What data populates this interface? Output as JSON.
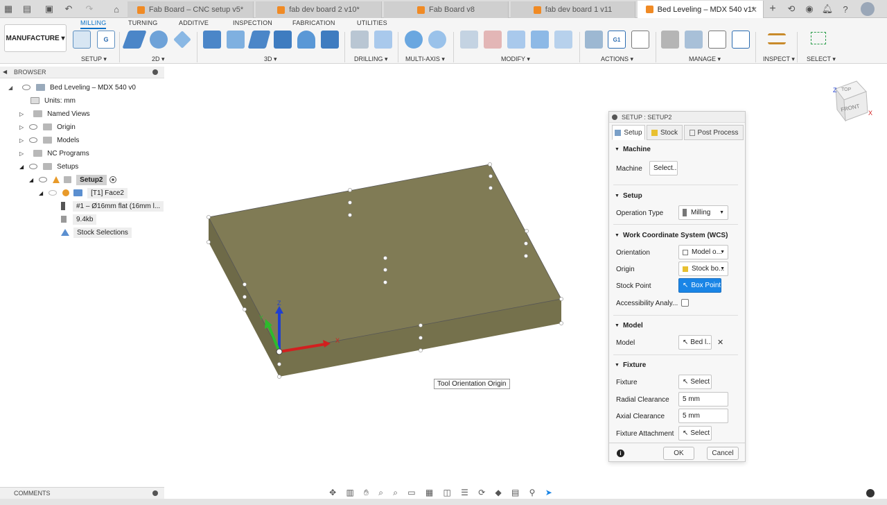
{
  "tabs": [
    {
      "label": "Fab Board – CNC setup v5*"
    },
    {
      "label": "fab dev board 2 v10*"
    },
    {
      "label": "Fab Board v8"
    },
    {
      "label": "fab dev board 1 v11"
    },
    {
      "label": "Bed Leveling – MDX 540 v1*"
    }
  ],
  "ribbon": {
    "workspace": "MANUFACTURE ▾",
    "tabs": [
      "MILLING",
      "TURNING",
      "ADDITIVE",
      "INSPECTION",
      "FABRICATION",
      "UTILITIES"
    ],
    "groups": [
      "SETUP ▾",
      "2D ▾",
      "3D ▾",
      "DRILLING ▾",
      "MULTI-AXIS ▾",
      "MODIFY ▾",
      "ACTIONS ▾",
      "MANAGE ▾",
      "INSPECT ▾",
      "SELECT ▾"
    ]
  },
  "browser": {
    "title": "BROWSER",
    "items": [
      {
        "label": "Bed Leveling – MDX 540 v0"
      },
      {
        "label": "Units: mm"
      },
      {
        "label": "Named Views"
      },
      {
        "label": "Origin"
      },
      {
        "label": "Models"
      },
      {
        "label": "NC Programs"
      },
      {
        "label": "Setups"
      },
      {
        "label": "Setup2"
      },
      {
        "label": "[T1] Face2"
      },
      {
        "label": "#1 – Ø16mm flat (16mm l..."
      },
      {
        "label": "9.4kb"
      },
      {
        "label": "Stock Selections"
      }
    ]
  },
  "viewcube": {
    "top": "TOP",
    "front": "FRONT",
    "x": "X",
    "z": "Z"
  },
  "triad": {
    "x": "X",
    "y": "Y",
    "z": "Z"
  },
  "tooltip": "Tool Orientation Origin",
  "panel": {
    "title": "SETUP : SETUP2",
    "tabs": [
      "Setup",
      "Stock",
      "Post Process"
    ],
    "machine": {
      "heading": "Machine",
      "label": "Machine",
      "button": "Select..."
    },
    "setup": {
      "heading": "Setup",
      "op_label": "Operation Type",
      "op_value": "Milling"
    },
    "wcs": {
      "heading": "Work Coordinate System (WCS)",
      "orientation_label": "Orientation",
      "orientation_value": "Model o...",
      "origin_label": "Origin",
      "origin_value": "Stock bo...",
      "stock_point_label": "Stock Point",
      "stock_point_value": "Box Point",
      "access_label": "Accessibility Analy..."
    },
    "model": {
      "heading": "Model",
      "label": "Model",
      "value": "Bed l..."
    },
    "fixture": {
      "heading": "Fixture",
      "fixture_label": "Fixture",
      "fixture_value": "Select",
      "radial_label": "Radial Clearance",
      "radial_value": "5 mm",
      "axial_label": "Axial Clearance",
      "axial_value": "5 mm",
      "attach_label": "Fixture Attachment",
      "attach_value": "Select"
    },
    "ok": "OK",
    "cancel": "Cancel"
  },
  "comments": "COMMENTS",
  "colors": {
    "accent": "#0a72c8",
    "stock": "#807b55",
    "active_button": "#1a85e6"
  }
}
